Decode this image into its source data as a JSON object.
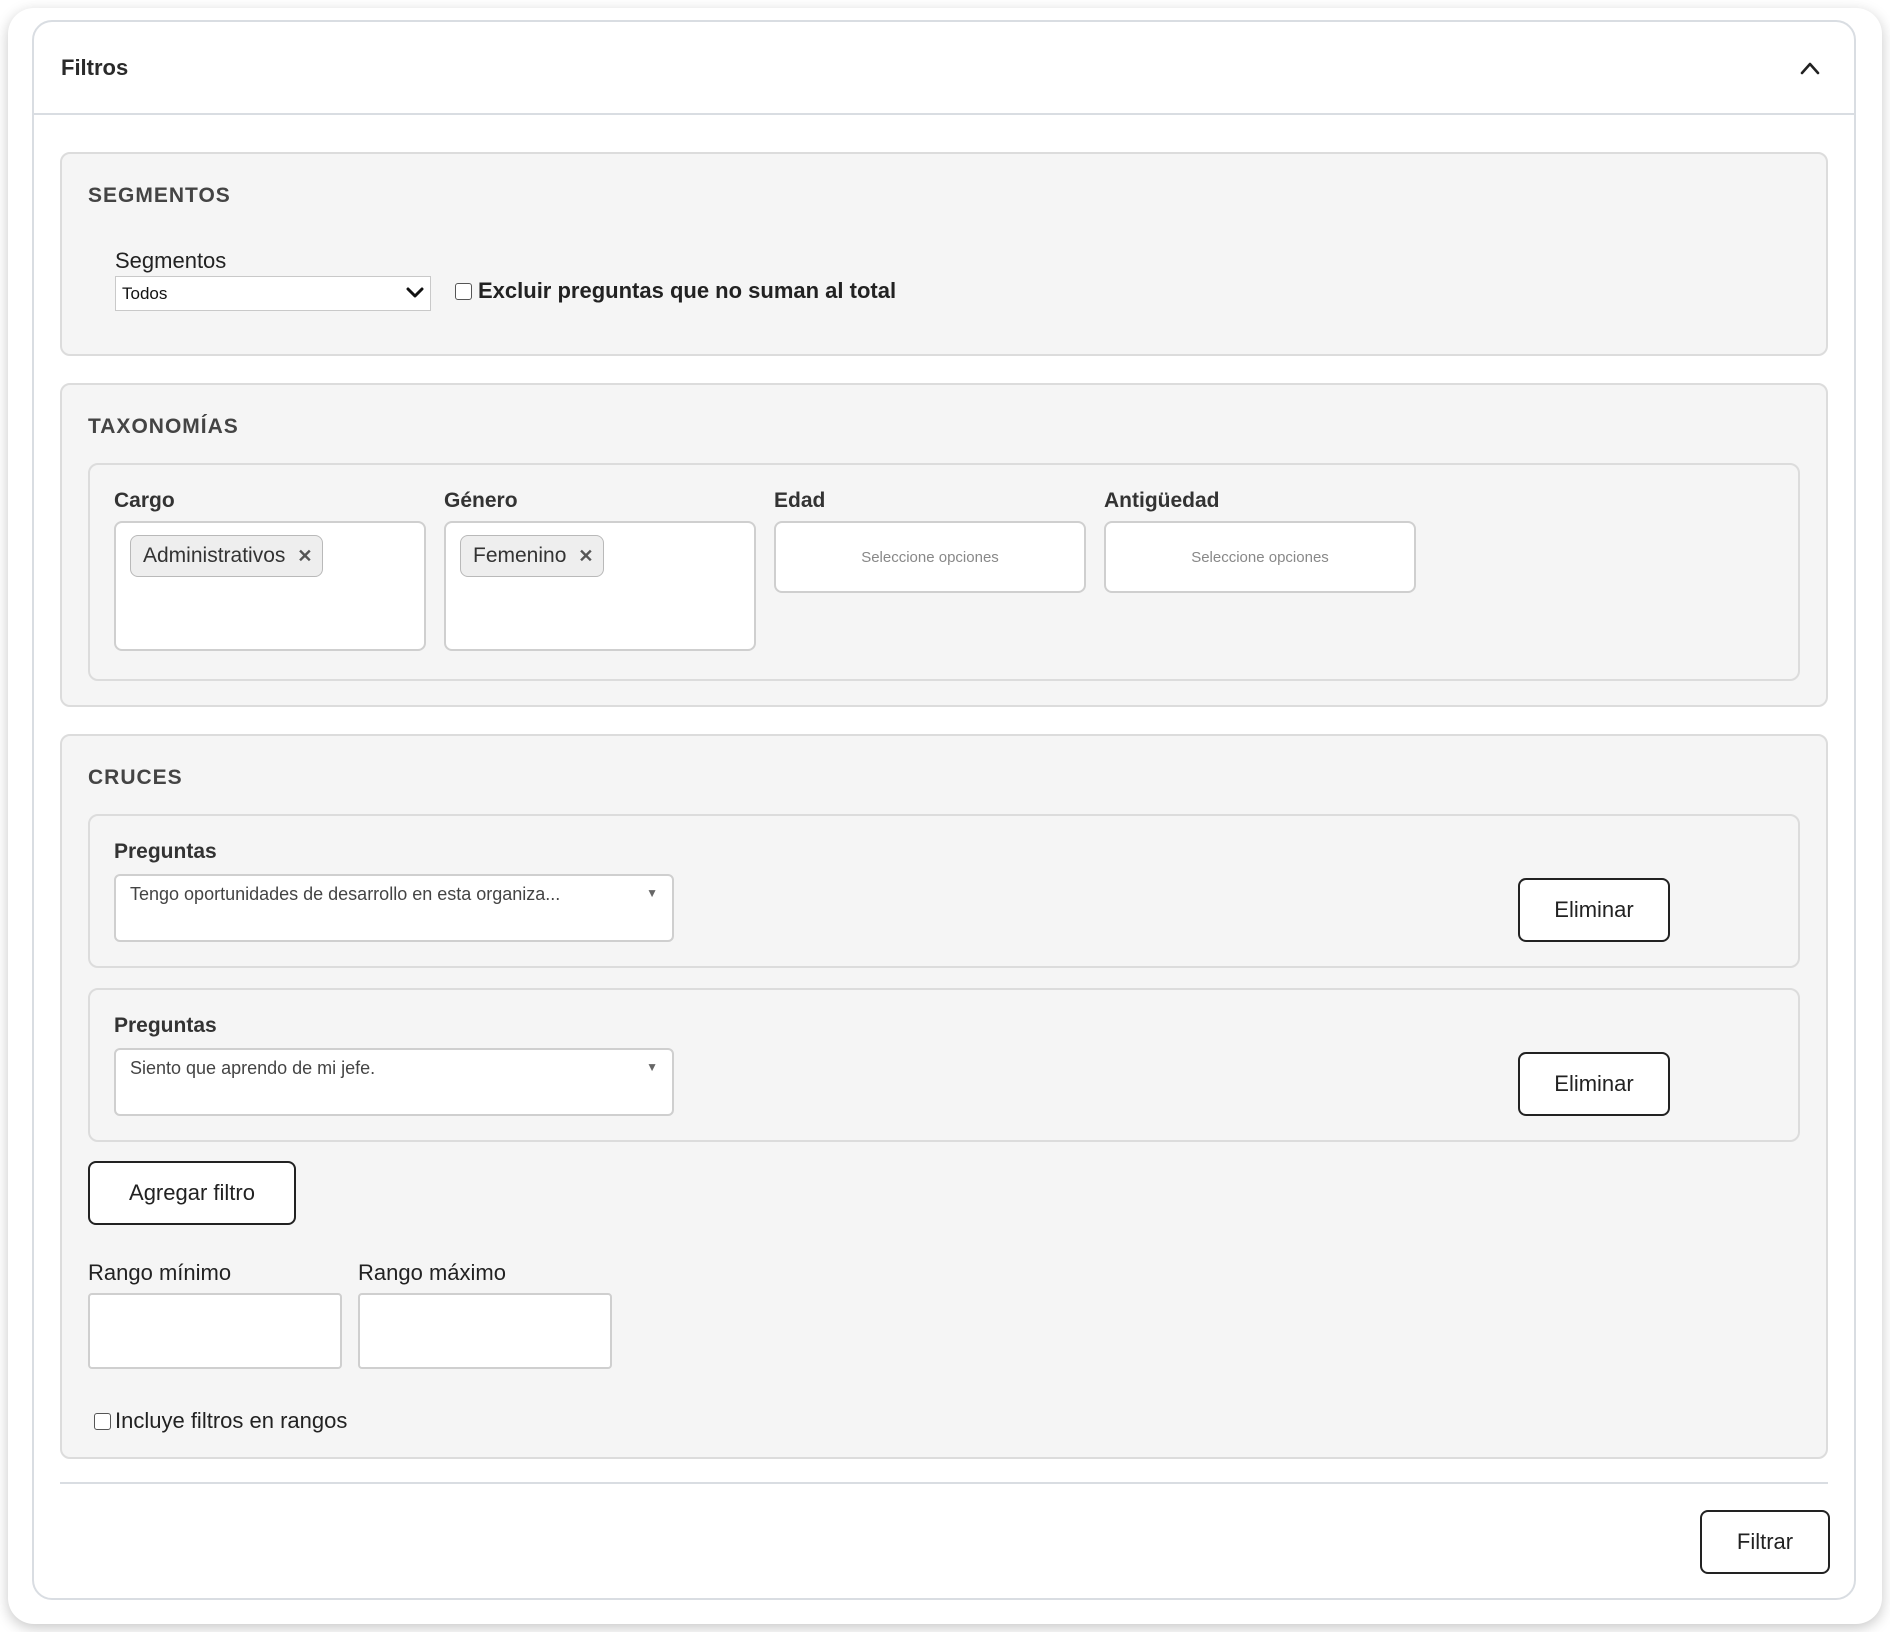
{
  "header": {
    "title": "Filtros"
  },
  "segmentos": {
    "section_title": "SEGMENTOS",
    "label": "Segmentos",
    "selected_value": "Todos",
    "exclude_checkbox_label": "Excluir preguntas que no suman al total",
    "exclude_checked": false
  },
  "taxonomias": {
    "section_title": "TAXONOMÍAS",
    "fields": [
      {
        "label": "Cargo",
        "tags": [
          "Administrativos"
        ],
        "placeholder": ""
      },
      {
        "label": "Género",
        "tags": [
          "Femenino"
        ],
        "placeholder": ""
      },
      {
        "label": "Edad",
        "tags": [],
        "placeholder": "Seleccione opciones"
      },
      {
        "label": "Antigüedad",
        "tags": [],
        "placeholder": "Seleccione opciones"
      }
    ]
  },
  "cruces": {
    "section_title": "CRUCES",
    "rows": [
      {
        "label": "Preguntas",
        "selected": "Tengo oportunidades de desarrollo en esta organiza...",
        "delete_label": "Eliminar"
      },
      {
        "label": "Preguntas",
        "selected": "Siento que aprendo de mi jefe.",
        "delete_label": "Eliminar"
      }
    ],
    "add_filter_label": "Agregar filtro",
    "range_min_label": "Rango mínimo",
    "range_max_label": "Rango máximo",
    "range_min_value": "",
    "range_max_value": "",
    "include_ranges_label": "Incluye filtros en rangos",
    "include_ranges_checked": false
  },
  "footer": {
    "filter_button_label": "Filtrar"
  }
}
